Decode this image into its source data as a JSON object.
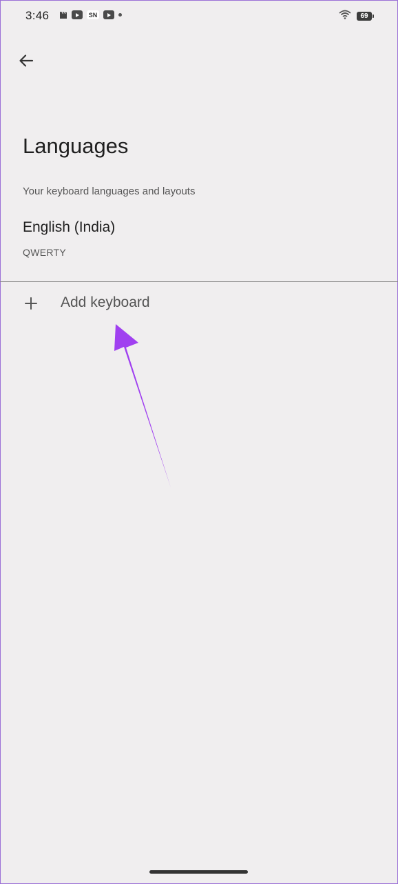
{
  "status_bar": {
    "time": "3:46",
    "notification_icons": [
      "clapperboard-icon",
      "youtube-icon",
      "sn-app-icon",
      "youtube-icon",
      "dot-icon"
    ],
    "sn_label": "SN",
    "battery_level": "69",
    "wifi": "wifi-icon"
  },
  "app_bar": {
    "back_icon": "arrow-back-icon"
  },
  "page": {
    "title": "Languages",
    "section_header": "Your keyboard languages and layouts"
  },
  "languages": [
    {
      "name": "English (India)",
      "layout": "QWERTY"
    }
  ],
  "add_keyboard": {
    "icon": "plus-icon",
    "label": "Add keyboard"
  },
  "annotation": {
    "color": "#a040f0"
  }
}
